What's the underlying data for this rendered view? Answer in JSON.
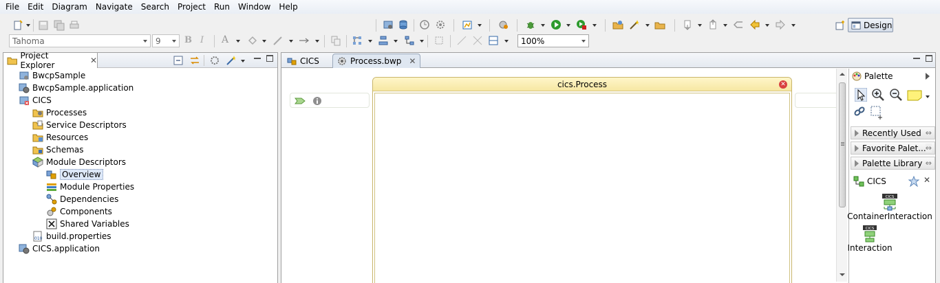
{
  "menu": [
    "File",
    "Edit",
    "Diagram",
    "Navigate",
    "Search",
    "Project",
    "Run",
    "Window",
    "Help"
  ],
  "toolbar": {
    "font_family": "Tahoma",
    "font_size": "9",
    "zoom": "100%",
    "design_label": "Design"
  },
  "project_explorer": {
    "title": "Project Explorer",
    "items": [
      {
        "label": "BwcpSample",
        "indent": 0,
        "icon": "project-icon"
      },
      {
        "label": "BwcpSample.application",
        "indent": 0,
        "icon": "application-icon"
      },
      {
        "label": "CICS",
        "indent": 0,
        "icon": "project-error-icon"
      },
      {
        "label": "Processes",
        "indent": 1,
        "icon": "folder-process-icon"
      },
      {
        "label": "Service Descriptors",
        "indent": 1,
        "icon": "folder-service-icon"
      },
      {
        "label": "Resources",
        "indent": 1,
        "icon": "folder-resource-icon"
      },
      {
        "label": "Schemas",
        "indent": 1,
        "icon": "folder-schema-icon"
      },
      {
        "label": "Module Descriptors",
        "indent": 1,
        "icon": "module-icon"
      },
      {
        "label": "Overview",
        "indent": 2,
        "icon": "overview-icon",
        "selected": true
      },
      {
        "label": "Module Properties",
        "indent": 2,
        "icon": "properties-icon"
      },
      {
        "label": "Dependencies",
        "indent": 2,
        "icon": "dependencies-icon"
      },
      {
        "label": "Components",
        "indent": 2,
        "icon": "components-icon"
      },
      {
        "label": "Shared Variables",
        "indent": 2,
        "icon": "shared-variables-icon"
      },
      {
        "label": "build.properties",
        "indent": 1,
        "icon": "build-file-icon"
      },
      {
        "label": "CICS.application",
        "indent": 0,
        "icon": "application-icon"
      }
    ]
  },
  "editor": {
    "tabs": [
      {
        "label": "CICS"
      },
      {
        "label": "Process.bwp",
        "active": true
      }
    ],
    "process_title": "cics.Process"
  },
  "palette": {
    "title": "Palette",
    "drawers": [
      "Recently Used",
      "Favorite Palet...",
      "Palette Library"
    ],
    "section": "CICS",
    "entries": [
      {
        "label": "ContainerInteraction",
        "badge": "CICS"
      },
      {
        "label": "Interaction",
        "badge": "CICS"
      }
    ]
  },
  "colors": {
    "process_header": "#f6e7a3",
    "selection": "#dde8f8",
    "close_red": "#d94040"
  }
}
